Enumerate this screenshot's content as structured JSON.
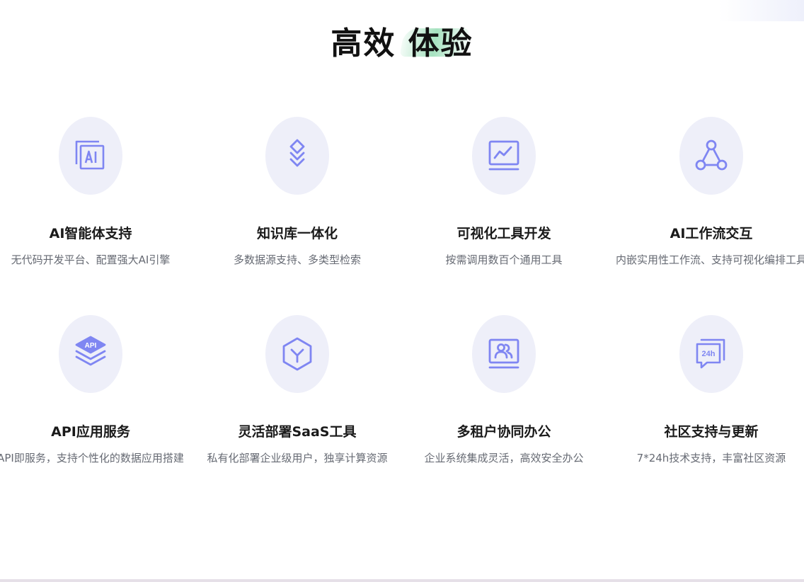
{
  "header": {
    "title": "高效 体验"
  },
  "colors": {
    "icon_stroke": "#7f86f2",
    "icon_bg": "#eeeff9",
    "title_highlight": "#9ed9b6"
  },
  "features": [
    {
      "icon": "ai-window-icon",
      "title": "AI智能体支持",
      "desc": "无代码开发平台、配置强大AI引擎"
    },
    {
      "icon": "layers-diamond-icon",
      "title": "知识库一体化",
      "desc": "多数据源支持、多类型检索"
    },
    {
      "icon": "chart-monitor-icon",
      "title": "可视化工具开发",
      "desc": "按需调用数百个通用工具"
    },
    {
      "icon": "workflow-nodes-icon",
      "title": "AI工作流交互",
      "desc": "内嵌实用性工作流、支持可视化编排工具"
    },
    {
      "icon": "api-stack-icon",
      "title": "API应用服务",
      "desc": "API即服务，支持个性化的数据应用搭建"
    },
    {
      "icon": "hexagon-y-icon",
      "title": "灵活部署SaaS工具",
      "desc": "私有化部署企业级用户，独享计算资源"
    },
    {
      "icon": "users-monitor-icon",
      "title": "多租户协同办公",
      "desc": "企业系统集成灵活，高效安全办公"
    },
    {
      "icon": "chat-24h-icon",
      "title": "社区支持与更新",
      "desc": "7*24h技术支持，丰富社区资源"
    }
  ]
}
